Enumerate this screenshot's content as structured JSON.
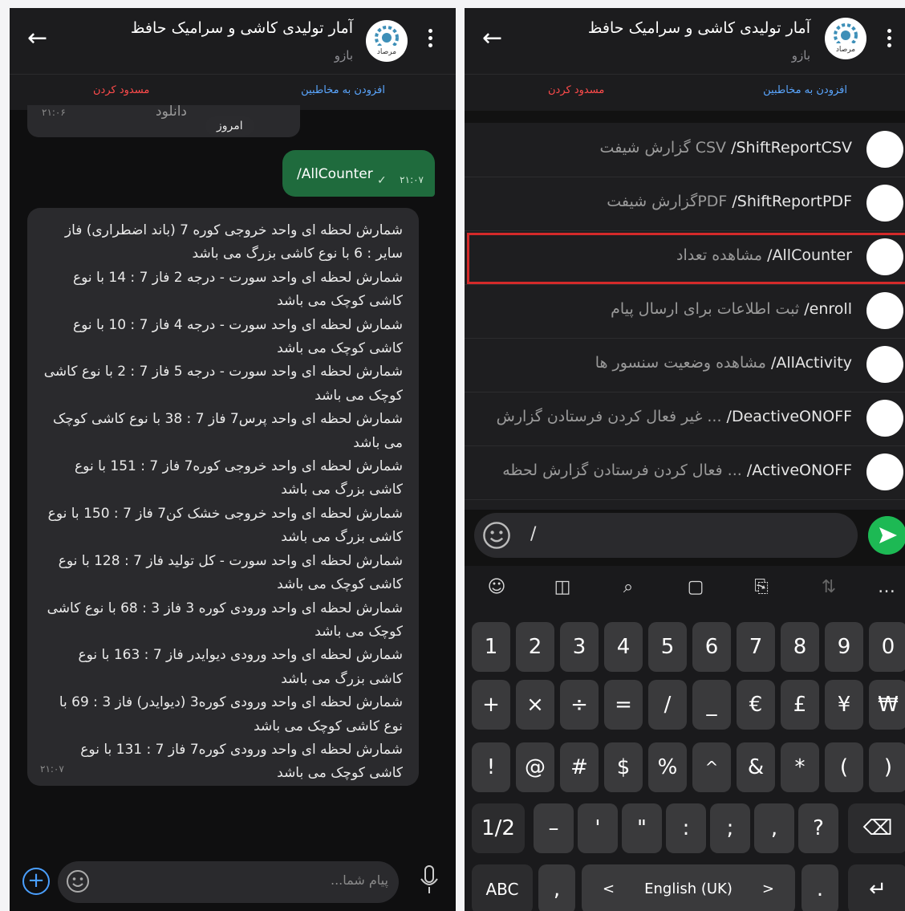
{
  "chat": {
    "title": "آمار تولیدی کاشی و سرامیک حافظ",
    "subtitle": "بازو",
    "avatar_text": "مرصاد",
    "add_contact": "افزودن به مخاطبین",
    "block": "مسدود کردن"
  },
  "left": {
    "prev_time": "۲۱:۰۶",
    "prev_download": "دانلود",
    "today": "امروز",
    "out_message": "/AllCounter",
    "out_time": "۲۱:۰۷",
    "in_message": "شمارش لحظه ای واحد خروجی کوره 7 (باند اضطراری) فاز سایر : 6  با نوع کاشی بزرگ می باشد\nشمارش لحظه ای واحد سورت - درجه 2 فاز 7 : 14  با نوع کاشی کوچک می باشد\nشمارش لحظه ای واحد سورت - درجه 4 فاز 7 : 10  با نوع کاشی کوچک می باشد\nشمارش لحظه ای واحد سورت - درجه 5 فاز 7 : 2  با نوع کاشی کوچک می باشد\nشمارش لحظه ای واحد پرس7 فاز 7 : 38  با نوع کاشی کوچک می باشد\nشمارش لحظه ای واحد خروجی کوره7 فاز 7 : 151  با نوع کاشی بزرگ می باشد\nشمارش لحظه ای واحد خروجی خشک کن7 فاز 7 : 150  با نوع کاشی بزرگ می باشد\nشمارش لحظه ای واحد سورت - کل تولید فاز 7 : 128  با نوع کاشی کوچک می باشد\nشمارش لحظه ای واحد ورودی کوره 3 فاز 3 : 68  با نوع کاشی کوچک می باشد\nشمارش لحظه ای واحد ورودی دیوایدر فاز 7 : 163  با نوع کاشی بزرگ می باشد\nشمارش لحظه ای واحد ورودی کوره3 (دیوایدر) فاز 3 : 69  با نوع کاشی کوچک می باشد\nشمارش لحظه ای واحد ورودی کوره7 فاز 7 : 131  با نوع کاشی کوچک می باشد",
    "in_time": "۲۱:۰۷",
    "input_placeholder": "پیام شما..."
  },
  "commands": [
    {
      "cmd": "/ShiftReportCSV",
      "desc": "گزارش شیفت CSV"
    },
    {
      "cmd": "/ShiftReportPDF",
      "desc": "گزارش شیفتPDF"
    },
    {
      "cmd": "/AllCounter",
      "desc": "مشاهده تعداد"
    },
    {
      "cmd": "/enroll",
      "desc": "ثبت اطلاعات برای ارسال پیام"
    },
    {
      "cmd": "/AllActivity",
      "desc": "مشاهده وضعیت سنسور ها"
    },
    {
      "cmd": "/DeactiveONOFF",
      "desc": "غیر فعال کردن فرستادن گزارش ..."
    },
    {
      "cmd": "/ActiveONOFF",
      "desc": "فعال کردن فرستادن گزارش لحظه ..."
    }
  ],
  "right": {
    "input_value": "/"
  },
  "keyboard": {
    "row1": [
      "1",
      "2",
      "3",
      "4",
      "5",
      "6",
      "7",
      "8",
      "9",
      "0"
    ],
    "row2": [
      "+",
      "×",
      "÷",
      "=",
      "/",
      "_",
      "€",
      "£",
      "¥",
      "₩"
    ],
    "row3": [
      "!",
      "@",
      "#",
      "$",
      "%",
      "^",
      "&",
      "*",
      "(",
      ")"
    ],
    "row4": [
      "1/2",
      "–",
      "'",
      "\"",
      ":",
      ";",
      ",",
      "?"
    ],
    "abc": "ABC",
    "comma": ",",
    "lang": "English (UK)",
    "lang_prev": "<",
    "lang_next": ">",
    "period": "."
  },
  "colors": {
    "accent_green": "#1db954",
    "link_blue": "#5aa6ff",
    "block_red": "#ff4b4b",
    "highlight": "#d42a2a"
  }
}
